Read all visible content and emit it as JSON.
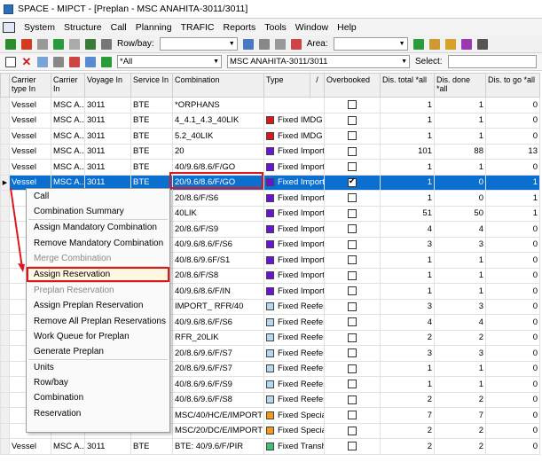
{
  "window": {
    "title": "SPACE - MIPCT - [Preplan - MSC ANAHITA-3011/3011]"
  },
  "menu": [
    "System",
    "Structure",
    "Call",
    "Planning",
    "TRAFIC",
    "Reports",
    "Tools",
    "Window",
    "Help"
  ],
  "toolbar1": {
    "rowbay_label": "Row/bay:",
    "area_label": "Area:"
  },
  "toolbar2": {
    "filter_value": "*All",
    "vessel_value": "MSC ANAHITA-3011/3011",
    "select_label": "Select:"
  },
  "columns": [
    "Carrier type In",
    "Carrier In",
    "Voyage In",
    "Service In",
    "Combination",
    "Type",
    "/",
    "Overbooked",
    "Dis. total *all",
    "Dis. done *all",
    "Dis. to go *all"
  ],
  "colors": {
    "red": "#e0161b",
    "purple": "#6a12d6",
    "lightblue": "#b5d8ee",
    "orange": "#f39a1d",
    "green": "#3fbf7a",
    "selected": "#0b6fcf"
  },
  "rows": [
    {
      "ct": "Vessel",
      "carrier": "MSC A...",
      "voyage": "3011",
      "service": "BTE",
      "combination": "*ORPHANS",
      "type": "",
      "color": "",
      "over": false,
      "total": "1",
      "done": "1",
      "togo": "0"
    },
    {
      "ct": "Vessel",
      "carrier": "MSC A...",
      "voyage": "3011",
      "service": "BTE",
      "combination": "4_4.1_4.3_40LIK",
      "type": "Fixed IMDG",
      "color": "#e0161b",
      "over": false,
      "total": "1",
      "done": "1",
      "togo": "0"
    },
    {
      "ct": "Vessel",
      "carrier": "MSC A...",
      "voyage": "3011",
      "service": "BTE",
      "combination": "5.2_40LIK",
      "type": "Fixed IMDG",
      "color": "#e0161b",
      "over": false,
      "total": "1",
      "done": "1",
      "togo": "0"
    },
    {
      "ct": "Vessel",
      "carrier": "MSC A...",
      "voyage": "3011",
      "service": "BTE",
      "combination": "20",
      "type": "Fixed Import",
      "color": "#6a12d6",
      "over": false,
      "total": "101",
      "done": "88",
      "togo": "13"
    },
    {
      "ct": "Vessel",
      "carrier": "MSC A...",
      "voyage": "3011",
      "service": "BTE",
      "combination": "40/9.6/8.6/F/GO",
      "type": "Fixed Import",
      "color": "#6a12d6",
      "over": false,
      "total": "1",
      "done": "1",
      "togo": "0"
    },
    {
      "ct": "Vessel",
      "carrier": "MSC A...",
      "voyage": "3011",
      "service": "BTE",
      "combination": "20/9.6/8.6/F/GO",
      "type": "Fixed Import",
      "color": "#6a12d6",
      "over": true,
      "total": "1",
      "done": "0",
      "togo": "1",
      "selected": true
    },
    {
      "ct": "",
      "carrier": "",
      "voyage": "",
      "service": "",
      "combination": "20/8.6/F/S6",
      "type": "Fixed Import",
      "color": "#6a12d6",
      "over": false,
      "total": "1",
      "done": "0",
      "togo": "1"
    },
    {
      "ct": "",
      "carrier": "",
      "voyage": "",
      "service": "",
      "combination": "40LIK",
      "type": "Fixed Import",
      "color": "#6a12d6",
      "over": false,
      "total": "51",
      "done": "50",
      "togo": "1"
    },
    {
      "ct": "",
      "carrier": "",
      "voyage": "",
      "service": "",
      "combination": "20/8.6/F/S9",
      "type": "Fixed Import",
      "color": "#6a12d6",
      "over": false,
      "total": "4",
      "done": "4",
      "togo": "0"
    },
    {
      "ct": "",
      "carrier": "",
      "voyage": "",
      "service": "",
      "combination": "40/9.6/8.6/F/S6",
      "type": "Fixed Import",
      "color": "#6a12d6",
      "over": false,
      "total": "3",
      "done": "3",
      "togo": "0"
    },
    {
      "ct": "",
      "carrier": "",
      "voyage": "",
      "service": "",
      "combination": "40/8.6/9.6F/S1",
      "type": "Fixed Import",
      "color": "#6a12d6",
      "over": false,
      "total": "1",
      "done": "1",
      "togo": "0"
    },
    {
      "ct": "",
      "carrier": "",
      "voyage": "",
      "service": "",
      "combination": "20/8.6/F/S8",
      "type": "Fixed Import",
      "color": "#6a12d6",
      "over": false,
      "total": "1",
      "done": "1",
      "togo": "0"
    },
    {
      "ct": "",
      "carrier": "",
      "voyage": "",
      "service": "",
      "combination": "40/9.6/8.6/F/IN",
      "type": "Fixed Import",
      "color": "#6a12d6",
      "over": false,
      "total": "1",
      "done": "1",
      "togo": "0"
    },
    {
      "ct": "",
      "carrier": "",
      "voyage": "",
      "service": "",
      "combination": "IMPORT_ RFR/40",
      "type": "Fixed Reefer",
      "color": "#b5d8ee",
      "over": false,
      "total": "3",
      "done": "3",
      "togo": "0"
    },
    {
      "ct": "",
      "carrier": "",
      "voyage": "",
      "service": "",
      "combination": "40/9.6/8.6/F/S6",
      "type": "Fixed Reefer",
      "color": "#b5d8ee",
      "over": false,
      "total": "4",
      "done": "4",
      "togo": "0"
    },
    {
      "ct": "",
      "carrier": "",
      "voyage": "",
      "service": "",
      "combination": "RFR_20LIK",
      "type": "Fixed Reefer",
      "color": "#b5d8ee",
      "over": false,
      "total": "2",
      "done": "2",
      "togo": "0"
    },
    {
      "ct": "",
      "carrier": "",
      "voyage": "",
      "service": "",
      "combination": "20/8.6/9.6/F/S7",
      "type": "Fixed Reefer",
      "color": "#b5d8ee",
      "over": false,
      "total": "3",
      "done": "3",
      "togo": "0"
    },
    {
      "ct": "",
      "carrier": "",
      "voyage": "",
      "service": "",
      "combination": "20/8.6/9.6/F/S7",
      "type": "Fixed Reefer",
      "color": "#b5d8ee",
      "over": false,
      "total": "1",
      "done": "1",
      "togo": "0"
    },
    {
      "ct": "",
      "carrier": "",
      "voyage": "",
      "service": "",
      "combination": "40/8.6/9.6/F/S9",
      "type": "Fixed Reefer",
      "color": "#b5d8ee",
      "over": false,
      "total": "1",
      "done": "1",
      "togo": "0"
    },
    {
      "ct": "",
      "carrier": "",
      "voyage": "",
      "service": "",
      "combination": "40/8.6/9.6/F/S8",
      "type": "Fixed Reefer",
      "color": "#b5d8ee",
      "over": false,
      "total": "2",
      "done": "2",
      "togo": "0"
    },
    {
      "ct": "",
      "carrier": "",
      "voyage": "",
      "service": "",
      "combination": "MSC/40/HC/E/IMPORT",
      "type": "Fixed Special",
      "color": "#f39a1d",
      "over": false,
      "total": "7",
      "done": "7",
      "togo": "0"
    },
    {
      "ct": "",
      "carrier": "",
      "voyage": "",
      "service": "",
      "combination": "MSC/20/DC/E/IMPORT",
      "type": "Fixed Special",
      "color": "#f39a1d",
      "over": false,
      "total": "2",
      "done": "2",
      "togo": "0"
    },
    {
      "ct": "Vessel",
      "carrier": "MSC A...",
      "voyage": "3011",
      "service": "BTE",
      "combination": "BTE: 40/9.6/F/PIR",
      "type": "Fixed Tranship",
      "color": "#3fbf7a",
      "over": false,
      "total": "2",
      "done": "2",
      "togo": "0"
    }
  ],
  "context_menu": [
    {
      "label": "Call",
      "disabled": false
    },
    {
      "label": "Combination Summary",
      "disabled": false
    },
    {
      "divider": true
    },
    {
      "label": "Assign Mandatory Combination",
      "disabled": false
    },
    {
      "label": "Remove Mandatory Combination",
      "disabled": false
    },
    {
      "label": "Merge Combination",
      "disabled": true
    },
    {
      "divider": true
    },
    {
      "label": "Assign Reservation",
      "disabled": false,
      "highlight": true
    },
    {
      "divider": true
    },
    {
      "label": "Preplan Reservation",
      "disabled": true
    },
    {
      "label": "Assign Preplan Reservation",
      "disabled": false
    },
    {
      "label": "Remove All Preplan Reservations",
      "disabled": false
    },
    {
      "label": "Work Queue for Preplan",
      "disabled": false
    },
    {
      "label": "Generate Preplan",
      "disabled": false
    },
    {
      "divider": true
    },
    {
      "label": "Units",
      "disabled": false
    },
    {
      "label": "Row/bay",
      "disabled": false
    },
    {
      "label": "Combination",
      "disabled": false
    },
    {
      "label": "Reservation",
      "disabled": false
    }
  ]
}
